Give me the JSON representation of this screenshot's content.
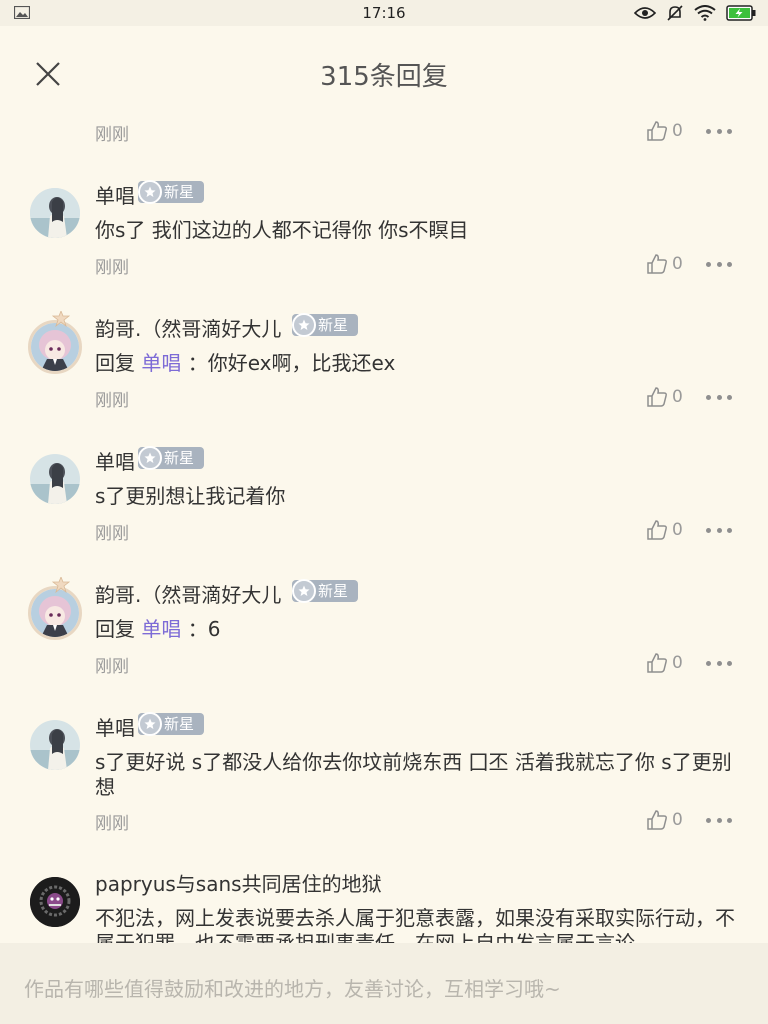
{
  "status_bar": {
    "time": "17:16"
  },
  "header": {
    "title": "315条回复"
  },
  "icons": {
    "close": "close-icon",
    "like": "thumbs-up-icon",
    "more": "more-dots-icon",
    "badge_star": "star-icon"
  },
  "colors": {
    "background": "#fcf8ec",
    "reply_name": "#7d6bd6",
    "badge": "#a9b3bf",
    "muted": "#9a9a9a"
  },
  "comments": [
    {
      "time": "刚刚",
      "likes": "0"
    },
    {
      "name": "单唱",
      "badge": "新星",
      "text": "你s了 我们这边的人都不记得你 你s不瞑目",
      "time": "刚刚",
      "likes": "0"
    },
    {
      "name": "韵哥.（然哥滴好大儿",
      "badge": "新星",
      "reply_prefix": "回复",
      "reply_to": "单唱",
      "text": "：你好ex啊，比我还ex",
      "time": "刚刚",
      "likes": "0"
    },
    {
      "name": "单唱",
      "badge": "新星",
      "text": "s了更别想让我记着你",
      "time": "刚刚",
      "likes": "0"
    },
    {
      "name": "韵哥.（然哥滴好大儿",
      "badge": "新星",
      "reply_prefix": "回复",
      "reply_to": "单唱",
      "text": "：6",
      "time": "刚刚",
      "likes": "0"
    },
    {
      "name": "单唱",
      "badge": "新星",
      "text": "s了更好说 s了都没人给你去你坟前烧东西 囗丕 活着我就忘了你 s了更别想",
      "time": "刚刚",
      "likes": "0"
    },
    {
      "name": "papryus与sans共同居住的地狱",
      "text": "不犯法，网上发表说要去杀人属于犯意表露，如果没有采取实际行动，不属于犯罪，也不需要承担刑事责任，在网上自由发言属于言论"
    }
  ],
  "input": {
    "placeholder": "作品有哪些值得鼓励和改进的地方，友善讨论，互相学习哦~"
  }
}
